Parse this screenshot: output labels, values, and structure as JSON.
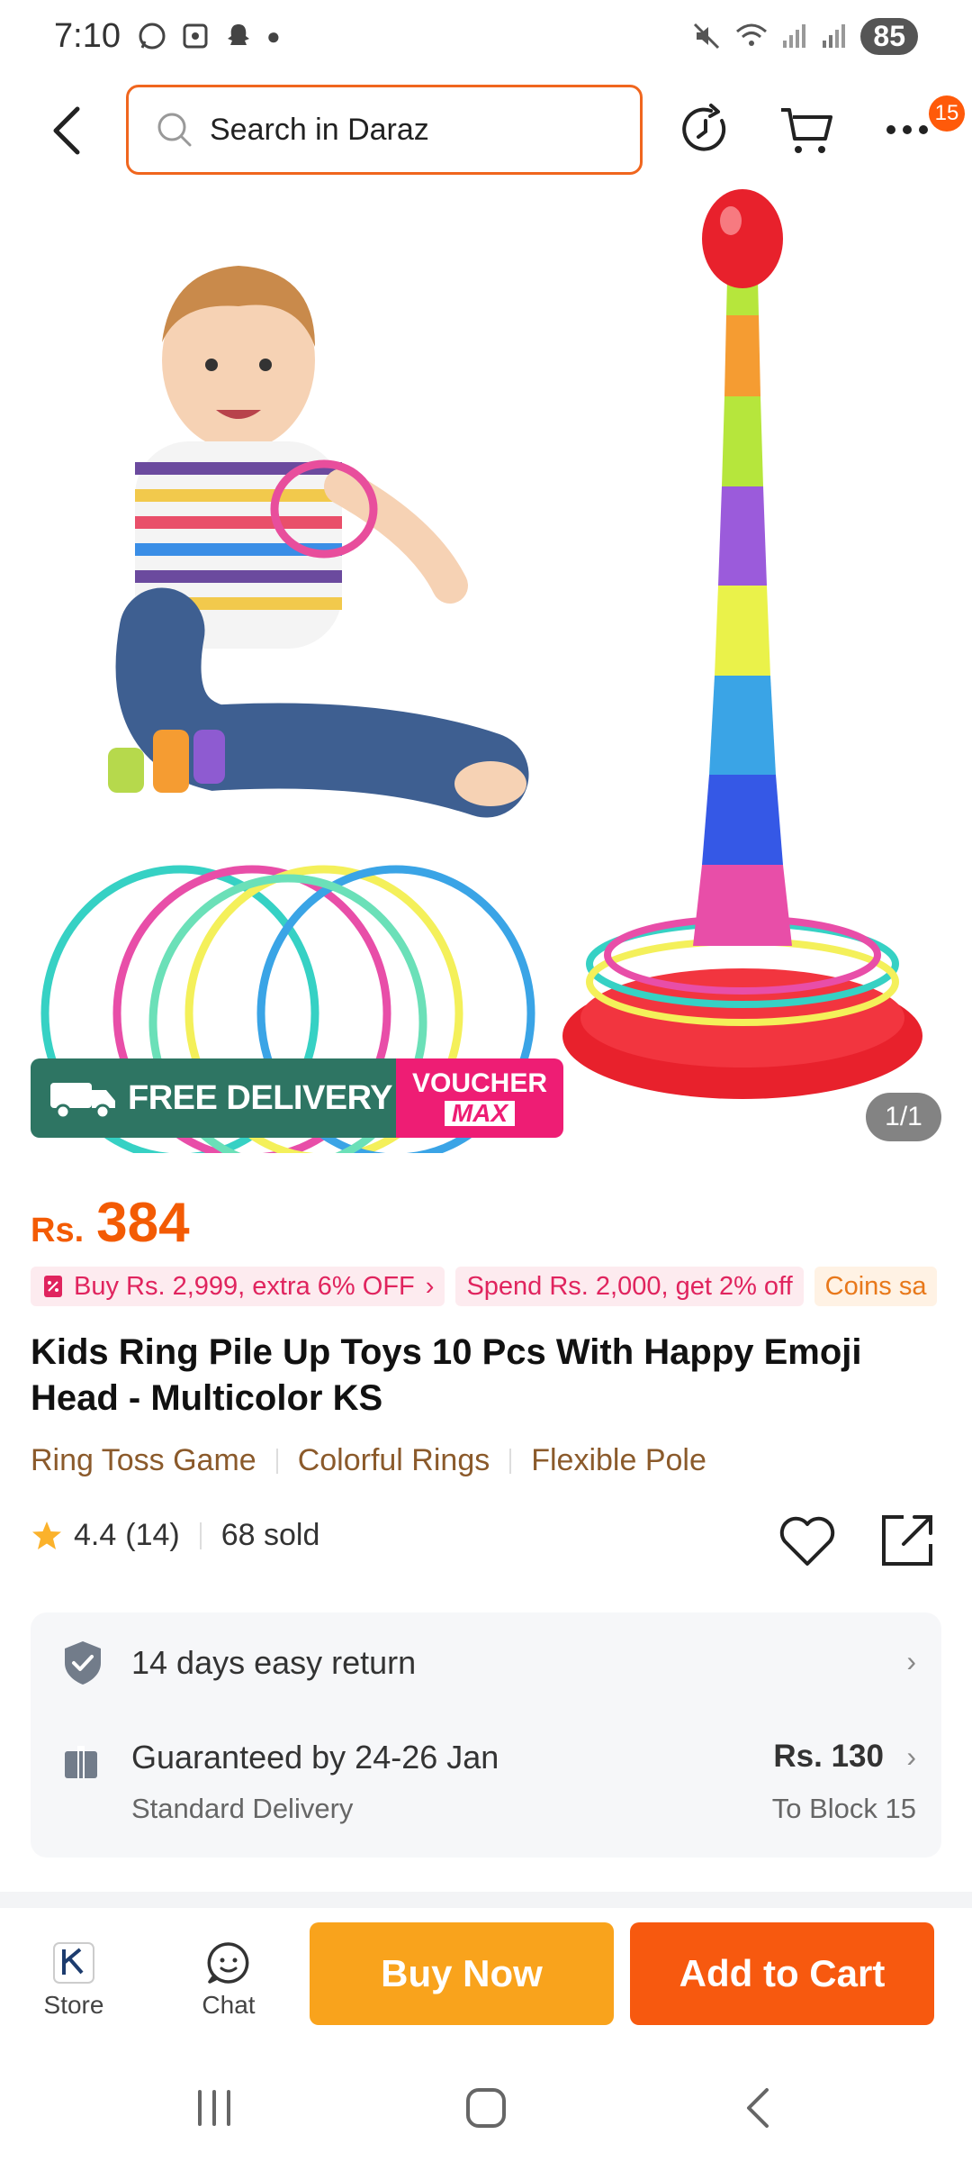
{
  "status_bar": {
    "time": "7:10",
    "battery": "85"
  },
  "header": {
    "search_placeholder": "Search in Daraz",
    "more_badge": "15"
  },
  "gallery": {
    "promo_free_delivery": "FREE DELIVERY",
    "promo_voucher_line1": "VOUCHER",
    "promo_voucher_line2": "MAX",
    "counter": "1/1"
  },
  "product": {
    "currency": "Rs.",
    "price": "384",
    "promo_chips": [
      "Buy Rs. 2,999, extra 6% OFF",
      "Spend Rs. 2,000, get 2% off",
      "Coins sa"
    ],
    "title": "Kids Ring Pile Up Toys 10 Pcs With Happy Emoji Head - Multicolor KS",
    "tags": [
      "Ring Toss Game",
      "Colorful Rings",
      "Flexible Pole"
    ],
    "rating": "4.4",
    "reviews": "(14)",
    "sold": "68 sold"
  },
  "info": {
    "return_text": "14 days easy return",
    "delivery_main": "Guaranteed by 24-26 Jan",
    "delivery_sub": "Standard Delivery",
    "delivery_price": "Rs. 130",
    "delivery_dest": "To Block 15"
  },
  "bottom_bar": {
    "store_label": "Store",
    "chat_label": "Chat",
    "buy_now": "Buy Now",
    "add_to_cart": "Add to Cart"
  },
  "colors": {
    "accent_orange": "#f7590f",
    "buy_yellow": "#f9a31c",
    "price_orange": "#f35b04",
    "free_delivery_green": "#2e7563",
    "voucher_pink": "#ee1d74"
  }
}
